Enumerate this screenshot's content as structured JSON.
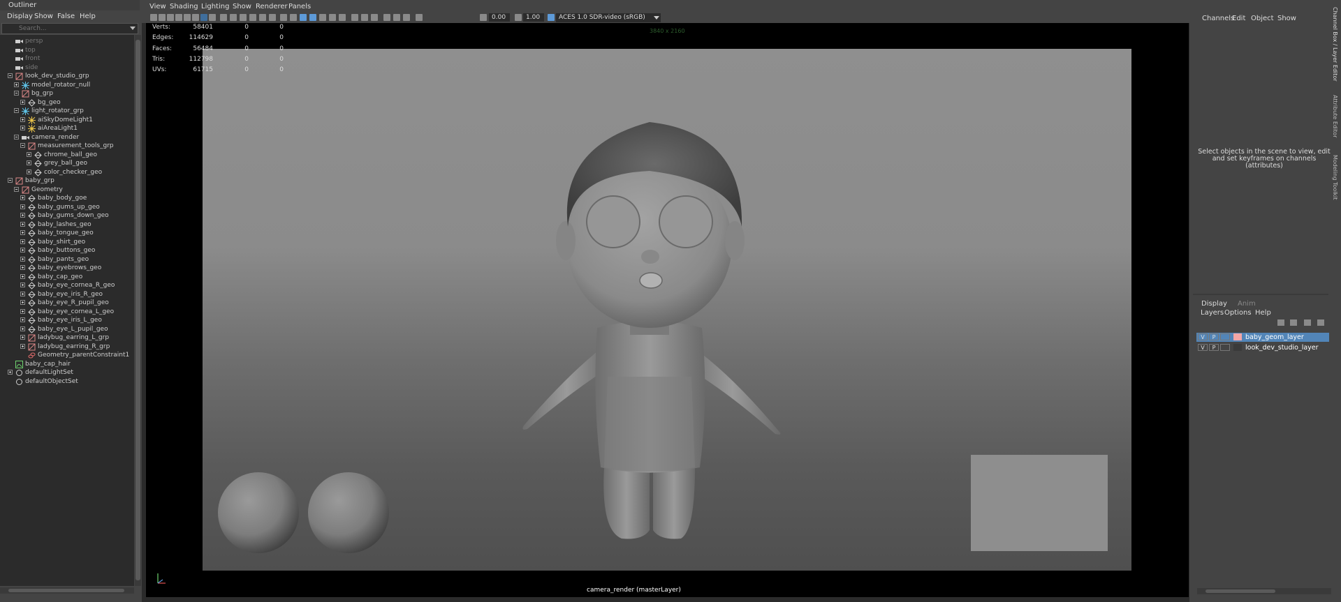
{
  "outliner": {
    "title": "Outliner",
    "menu": [
      "Display",
      "Show",
      "False",
      "Help"
    ],
    "search_placeholder": "Search...",
    "items": [
      {
        "label": "persp",
        "depth": 0,
        "icon": "camera-icon",
        "expand": "",
        "dim": true
      },
      {
        "label": "top",
        "depth": 0,
        "icon": "camera-icon",
        "expand": "",
        "dim": true
      },
      {
        "label": "front",
        "depth": 0,
        "icon": "camera-icon",
        "expand": "",
        "dim": true
      },
      {
        "label": "side",
        "depth": 0,
        "icon": "camera-icon",
        "expand": "",
        "dim": true
      },
      {
        "label": "look_dev_studio_grp",
        "depth": 0,
        "icon": "group-icon",
        "expand": "minus"
      },
      {
        "label": "model_rotator_null",
        "depth": 1,
        "icon": "locator-icon",
        "expand": "plus"
      },
      {
        "label": "bg_grp",
        "depth": 1,
        "icon": "group-icon",
        "expand": "minus"
      },
      {
        "label": "bg_geo",
        "depth": 2,
        "icon": "mesh-icon",
        "expand": "plus"
      },
      {
        "label": "light_rotator_grp",
        "depth": 1,
        "icon": "locator-icon",
        "expand": "minus"
      },
      {
        "label": "aiSkyDomeLight1",
        "depth": 2,
        "icon": "skydome-icon",
        "expand": "plus"
      },
      {
        "label": "aiAreaLight1",
        "depth": 2,
        "icon": "light-icon",
        "expand": "plus"
      },
      {
        "label": "camera_render",
        "depth": 1,
        "icon": "camera-icon",
        "expand": "minus"
      },
      {
        "label": "measurement_tools_grp",
        "depth": 2,
        "icon": "group-icon",
        "expand": "minus"
      },
      {
        "label": "chrome_ball_geo",
        "depth": 3,
        "icon": "mesh-icon",
        "expand": "plus"
      },
      {
        "label": "grey_ball_geo",
        "depth": 3,
        "icon": "mesh-icon",
        "expand": "plus"
      },
      {
        "label": "color_checker_geo",
        "depth": 3,
        "icon": "mesh-icon",
        "expand": "plus"
      },
      {
        "label": "baby_grp",
        "depth": 0,
        "icon": "group-icon",
        "expand": "minus"
      },
      {
        "label": "Geometry",
        "depth": 1,
        "icon": "group-icon",
        "expand": "minus"
      },
      {
        "label": "baby_body_goe",
        "depth": 2,
        "icon": "mesh-icon",
        "expand": "plus"
      },
      {
        "label": "baby_gums_up_geo",
        "depth": 2,
        "icon": "mesh-icon",
        "expand": "plus"
      },
      {
        "label": "baby_gums_down_geo",
        "depth": 2,
        "icon": "mesh-icon",
        "expand": "plus"
      },
      {
        "label": "baby_lashes_geo",
        "depth": 2,
        "icon": "mesh-icon",
        "expand": "plus"
      },
      {
        "label": "baby_tongue_geo",
        "depth": 2,
        "icon": "mesh-icon",
        "expand": "plus"
      },
      {
        "label": "baby_shirt_geo",
        "depth": 2,
        "icon": "mesh-icon",
        "expand": "plus"
      },
      {
        "label": "baby_buttons_geo",
        "depth": 2,
        "icon": "mesh-icon",
        "expand": "plus"
      },
      {
        "label": "baby_pants_geo",
        "depth": 2,
        "icon": "mesh-icon",
        "expand": "plus"
      },
      {
        "label": "baby_eyebrows_geo",
        "depth": 2,
        "icon": "mesh-icon",
        "expand": "plus"
      },
      {
        "label": "baby_cap_geo",
        "depth": 2,
        "icon": "mesh-icon",
        "expand": "plus"
      },
      {
        "label": "baby_eye_cornea_R_geo",
        "depth": 2,
        "icon": "mesh-icon",
        "expand": "plus"
      },
      {
        "label": "baby_eye_iris_R_geo",
        "depth": 2,
        "icon": "mesh-icon",
        "expand": "plus"
      },
      {
        "label": "baby_eye_R_pupil_geo",
        "depth": 2,
        "icon": "mesh-icon",
        "expand": "plus"
      },
      {
        "label": "baby_eye_cornea_L_geo",
        "depth": 2,
        "icon": "mesh-icon",
        "expand": "plus"
      },
      {
        "label": "baby_eye_iris_L_geo",
        "depth": 2,
        "icon": "mesh-icon",
        "expand": "plus"
      },
      {
        "label": "baby_eye_L_pupil_geo",
        "depth": 2,
        "icon": "mesh-icon",
        "expand": "plus"
      },
      {
        "label": "ladybug_earring_L_grp",
        "depth": 2,
        "icon": "group-icon",
        "expand": "plus"
      },
      {
        "label": "ladybug_earring_R_grp",
        "depth": 2,
        "icon": "group-icon",
        "expand": "plus"
      },
      {
        "label": "Geometry_parentConstraint1",
        "depth": 2,
        "icon": "constraint-icon",
        "expand": ""
      },
      {
        "label": "baby_cap_hair",
        "depth": 0,
        "icon": "hair-icon",
        "expand": ""
      },
      {
        "label": "defaultLightSet",
        "depth": 0,
        "icon": "set-icon",
        "expand": "plus"
      },
      {
        "label": "defaultObjectSet",
        "depth": 0,
        "icon": "set-icon",
        "expand": ""
      }
    ]
  },
  "viewport": {
    "menu": [
      "View",
      "Shading",
      "Lighting",
      "Show",
      "Renderer",
      "Panels"
    ],
    "exposure": "0.00",
    "gamma": "1.00",
    "color_space": "ACES 1.0 SDR-video (sRGB)",
    "resolution": "3840 x 2160",
    "camera_label": "camera_render (masterLayer)",
    "hud": [
      {
        "label": "Verts:",
        "v1": "58401",
        "v2": "0",
        "v3": "0"
      },
      {
        "label": "Edges:",
        "v1": "114629",
        "v2": "0",
        "v3": "0"
      },
      {
        "label": "Faces:",
        "v1": "56484",
        "v2": "0",
        "v3": "0"
      },
      {
        "label": "Tris:",
        "v1": "112798",
        "v2": "0",
        "v3": "0"
      },
      {
        "label": "UVs:",
        "v1": "61715",
        "v2": "0",
        "v3": "0"
      }
    ]
  },
  "channel_box": {
    "menu": [
      "Channels",
      "Edit",
      "Object",
      "Show"
    ],
    "empty_message": "Select objects in the scene to view, edit and set keyframes on channels (attributes)",
    "side_tabs": [
      "Channel Box / Layer Editor",
      "Attribute Editor",
      "Modeling Toolkit"
    ]
  },
  "layer_editor": {
    "tabs": [
      "Display",
      "Anim"
    ],
    "menu": [
      "Layers",
      "Options",
      "Help"
    ],
    "layers": [
      {
        "v": "V",
        "p": "P",
        "name": "baby_geom_layer",
        "color": "#f3a6a6",
        "selected": true
      },
      {
        "v": "V",
        "p": "P",
        "name": "look_dev_studio_layer",
        "color": "",
        "selected": false
      }
    ]
  },
  "colors": {
    "accent": "#5d9ad8",
    "selected_row": "#5285b8"
  }
}
